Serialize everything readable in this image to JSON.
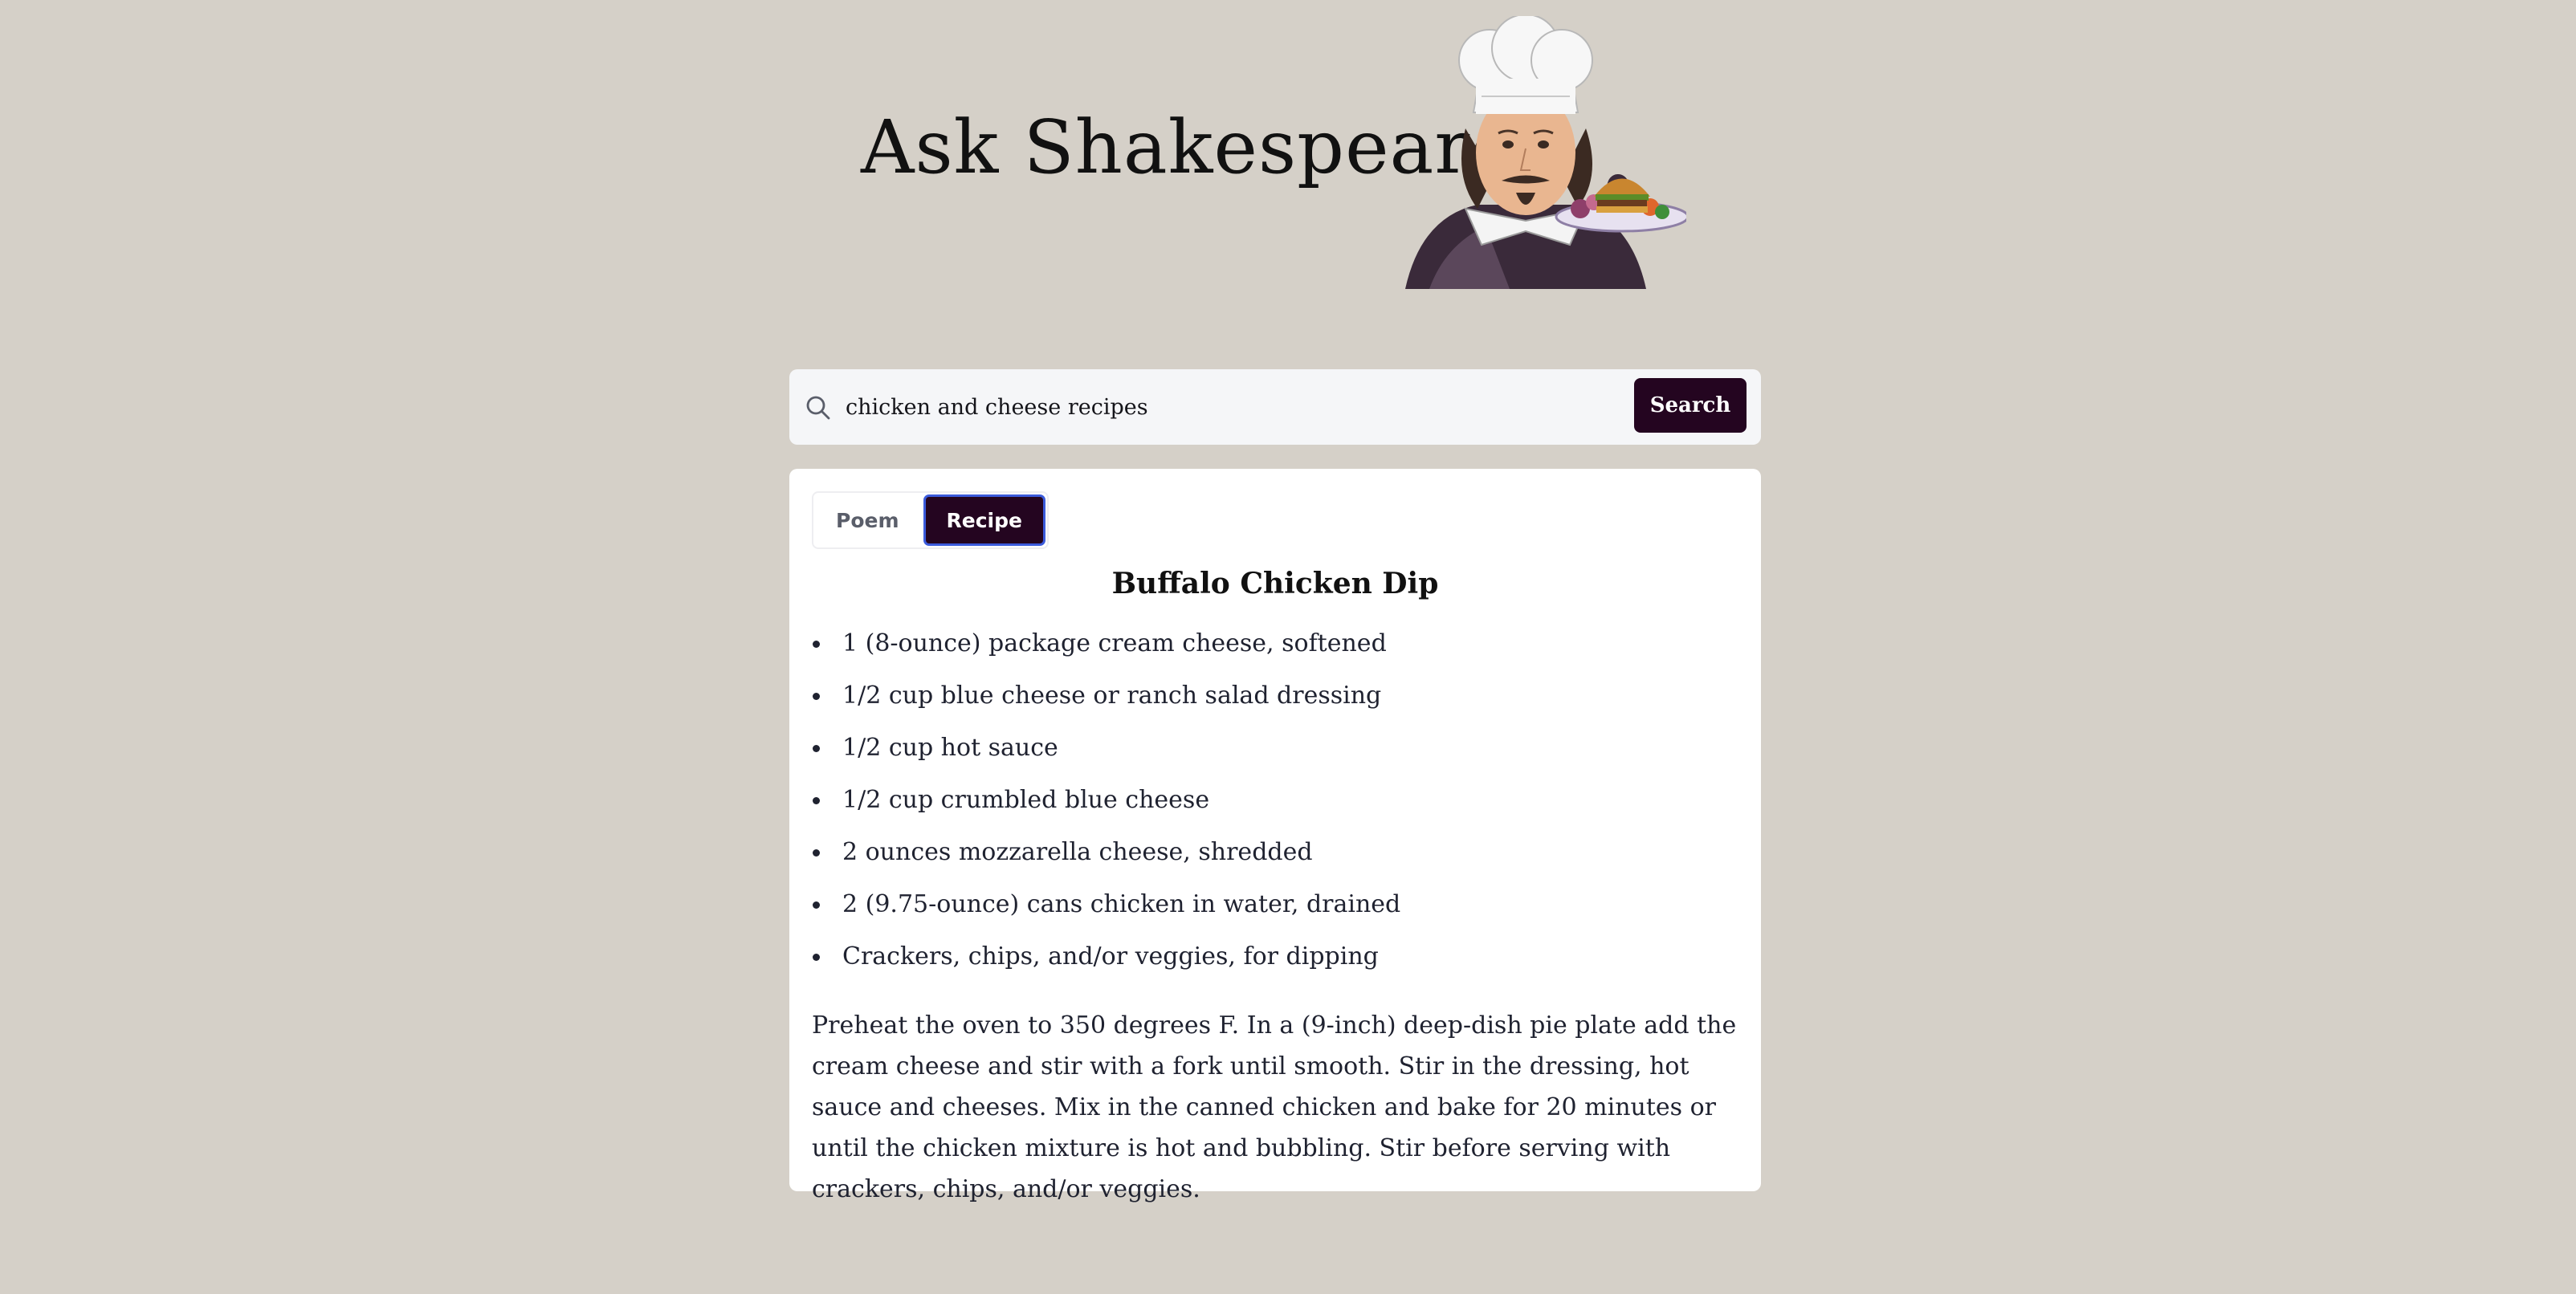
{
  "app": {
    "title": "Ask Shakespeare"
  },
  "header": {
    "mascot_icon": "shakespeare-chef-with-burger-plate-illustration"
  },
  "search": {
    "icon": "search-icon",
    "value": "chicken and cheese recipes",
    "placeholder": "",
    "button_label": "Search"
  },
  "tabs": [
    {
      "label": "Poem",
      "active": false
    },
    {
      "label": "Recipe",
      "active": true
    }
  ],
  "recipe": {
    "title": "Buffalo Chicken Dip",
    "ingredients": [
      "1 (8-ounce) package cream cheese, softened",
      "1/2 cup blue cheese or ranch salad dressing",
      "1/2 cup hot sauce",
      "1/2 cup crumbled blue cheese",
      "2 ounces mozzarella cheese, shredded",
      "2 (9.75-ounce) cans chicken in water, drained",
      "Crackers, chips, and/or veggies, for dipping"
    ],
    "instructions": "Preheat the oven to 350 degrees F. In a (9-inch) deep-dish pie plate add the cream cheese and stir with a fork until smooth. Stir in the dressing, hot sauce and cheeses. Mix in the canned chicken and bake for 20 minutes or until the chicken mixture is hot and bubbling. Stir before serving with crackers, chips, and/or veggies."
  },
  "colors": {
    "page_background": "#d5d0c8",
    "accent": "#240520",
    "active_tab_border": "#3b5bdb",
    "text": "#1f2230"
  }
}
